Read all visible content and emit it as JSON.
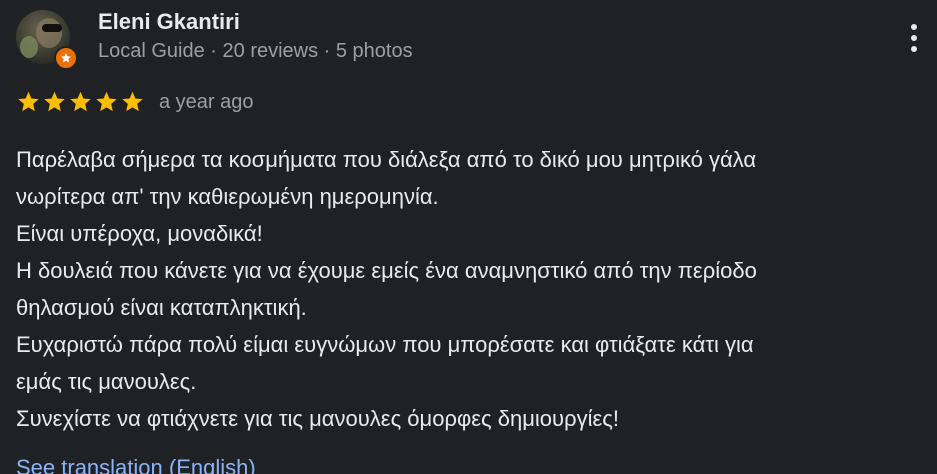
{
  "reviewer": {
    "name": "Eleni Gkantiri",
    "meta": "Local Guide · 20 reviews · 5 photos"
  },
  "rating": {
    "stars": 5,
    "max": 5,
    "star_color": "#fbbc04"
  },
  "time": "a year ago",
  "review_lines": [
    "Παρέλαβα σήμερα τα κοσμήματα που διάλεξα από το δικό μου μητρικό γάλα",
    "νωρίτερα απ' την καθιερωμένη ημερομηνία.",
    "Είναι υπέροχα, μοναδικά!",
    "Η δουλειά που κάνετε για να έχουμε εμείς ένα αναμνηστικό από την περίοδο",
    "θηλασμού είναι καταπληκτική.",
    "Ευχαριστώ πάρα πολύ είμαι ευγνώμων που μπορέσατε και φτιάξατε κάτι για",
    "εμάς τις μανουλες.",
    "Συνεχίστε να φτιάχνετε για τις μανουλες όμορφες δημιουργίες!"
  ],
  "translate_link": "See translation (English)",
  "icons": {
    "avatar": "profile-photo",
    "badge": "local-guide-badge-icon",
    "more": "more-vert-icon",
    "star": "star-icon"
  },
  "colors": {
    "background": "#202124",
    "text": "#e8eaed",
    "secondary_text": "#9aa0a6",
    "link": "#8ab4f8",
    "badge": "#e8710a"
  }
}
